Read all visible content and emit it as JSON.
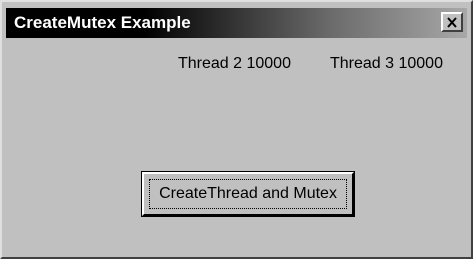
{
  "window": {
    "title": "CreateMutex Example",
    "close_icon": "close-icon"
  },
  "threads": [
    {
      "label": "Thread 2 10000"
    },
    {
      "label": "Thread 3 10000"
    }
  ],
  "actions": {
    "create_button_label": "CreateThread and Mutex"
  }
}
